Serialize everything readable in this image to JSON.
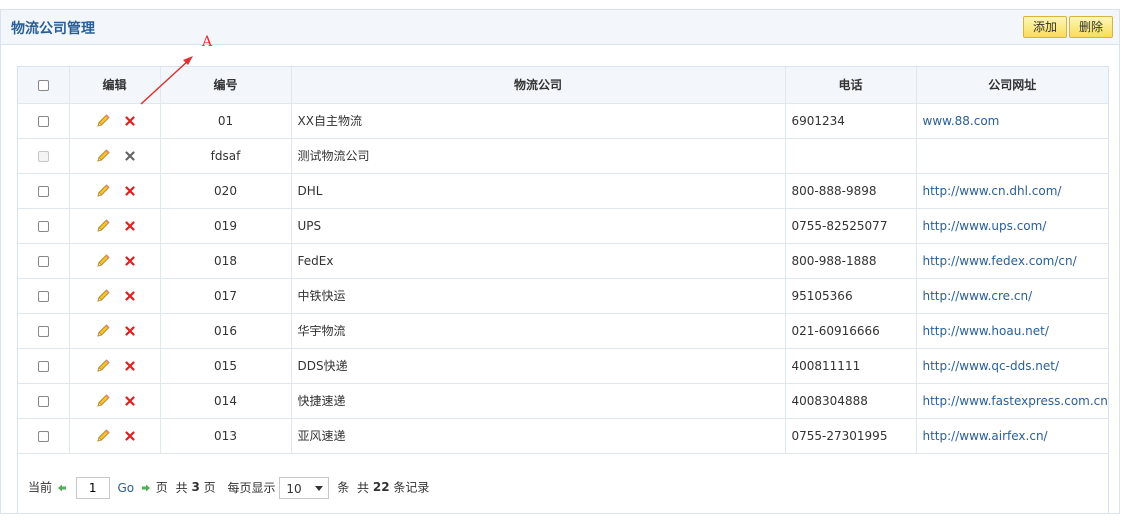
{
  "header": {
    "title": "物流公司管理",
    "add_label": "添加",
    "delete_label": "删除"
  },
  "annotation": {
    "label": "A",
    "color": "#e03030"
  },
  "table": {
    "columns": [
      "编辑",
      "编号",
      "物流公司",
      "电话",
      "公司网址"
    ],
    "rows": [
      {
        "code": "01",
        "company": "XX自主物流",
        "phone": "6901234",
        "url": "www.88.com",
        "disabled": false
      },
      {
        "code": "fdsaf",
        "company": "测试物流公司",
        "phone": "",
        "url": "",
        "disabled": true
      },
      {
        "code": "020",
        "company": "DHL",
        "phone": "800-888-9898",
        "url": "http://www.cn.dhl.com/",
        "disabled": false
      },
      {
        "code": "019",
        "company": "UPS",
        "phone": "0755-82525077",
        "url": "http://www.ups.com/",
        "disabled": false
      },
      {
        "code": "018",
        "company": "FedEx",
        "phone": "800-988-1888",
        "url": "http://www.fedex.com/cn/",
        "disabled": false
      },
      {
        "code": "017",
        "company": "中铁快运",
        "phone": "95105366",
        "url": "http://www.cre.cn/",
        "disabled": false
      },
      {
        "code": "016",
        "company": "华宇物流",
        "phone": "021-60916666",
        "url": "http://www.hoau.net/",
        "disabled": false
      },
      {
        "code": "015",
        "company": "DDS快递",
        "phone": "400811111",
        "url": "http://www.qc-dds.net/",
        "disabled": false
      },
      {
        "code": "014",
        "company": "快捷速递",
        "phone": "4008304888",
        "url": "http://www.fastexpress.com.cn/",
        "disabled": false
      },
      {
        "code": "013",
        "company": "亚风速递",
        "phone": "0755-27301995",
        "url": "http://www.airfex.cn/",
        "disabled": false
      }
    ]
  },
  "pager": {
    "current_label": "当前",
    "page_value": "1",
    "go_label": "Go",
    "page_word": "页",
    "total_prefix": "共",
    "total_pages": "3",
    "total_pages_suffix": "页",
    "per_page_label": "每页显示",
    "per_page_value": "10",
    "per_page_unit": "条",
    "total_records_prefix": "共",
    "total_records": "22",
    "total_records_suffix": "条记录"
  },
  "colors": {
    "accent": "#2a5f96",
    "button_yellow": "#f6de5a",
    "delete_red": "#e02020",
    "delete_disabled": "#666666",
    "arrow_green": "#4caf50"
  },
  "icons": {
    "edit": "pencil-icon",
    "delete": "cross-icon",
    "prev": "arrow-left-icon",
    "next": "arrow-right-icon"
  }
}
